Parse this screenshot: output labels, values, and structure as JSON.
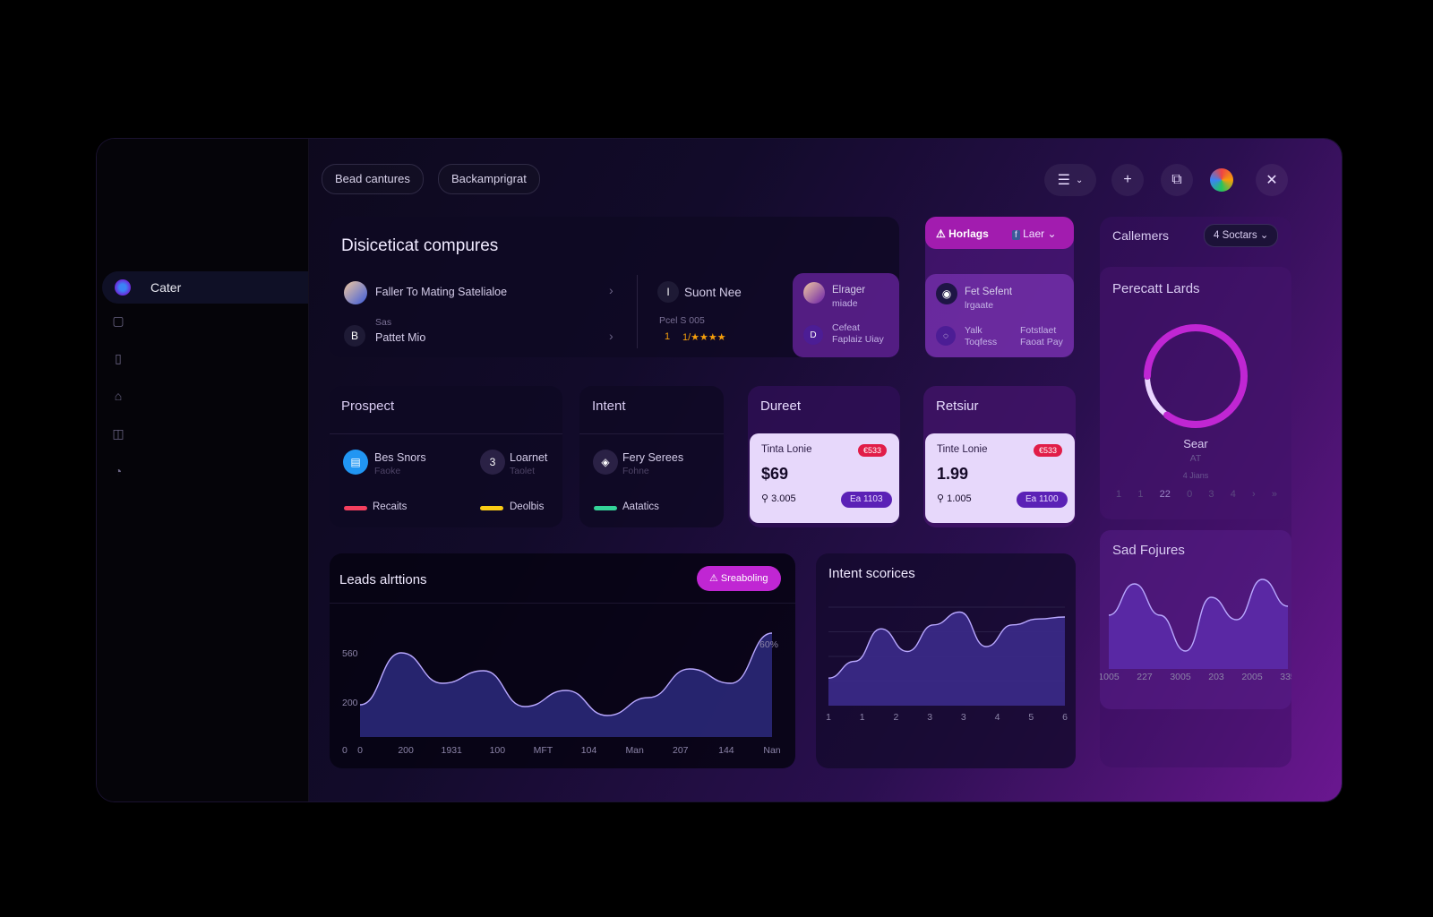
{
  "header": {
    "pill1": "Bead cantures",
    "pill2": "Backamprigrat"
  },
  "sidebar": {
    "active_label": "Cater"
  },
  "top_card": {
    "title": "Disiceticat compures",
    "item1": "Faller To Mating Satelialoe",
    "item2_sub": "Sas",
    "item2": "Pattet Mio",
    "item2_icon": "B",
    "mid_title": "Suont Nee",
    "mid_icon": "I",
    "mid_sub": "Pcel S 005",
    "mid_num": "1",
    "mid_stars": "1/★★★★",
    "mini1_title": "Elrager",
    "mini1_sub": "miade",
    "mini1_bottom_a": "Cefeat",
    "mini1_bottom_b": "Faplaiz Uiay",
    "mini1_icon": "D"
  },
  "right_top": {
    "tab1": "Horlags",
    "tab2": "Laer",
    "card_title": "Fet Sefent",
    "card_sub": "lrgaate",
    "foot_a1": "Yalk",
    "foot_a2": "Toqfess",
    "foot_b1": "Fotstlaet",
    "foot_b2": "Faoat Pay"
  },
  "far_right": {
    "title": "Callemers",
    "select": "Soctars",
    "select_prefix": "4",
    "gauge_title": "Perecatt Lards",
    "gauge_value": 0.85,
    "gauge_label": "Sear",
    "gauge_sub": "AT",
    "gauge_sub2": "4 Jians",
    "pager": [
      "1",
      "1",
      "22",
      "0",
      "3",
      "4",
      "›",
      "»"
    ],
    "chart_title": "Sad Fojures"
  },
  "prospect": {
    "title": "Prospect",
    "item1": "Bes Snors",
    "item1_sub": "Faoke",
    "item2": "Loarnet",
    "item2_sub": "Taolet",
    "item2_icon": "3",
    "leg1": "Recaits",
    "leg2": "Deolbis"
  },
  "intent": {
    "title": "Intent",
    "item": "Fery Serees",
    "item_sub": "Fohne",
    "leg": "Aatatics"
  },
  "duret": {
    "title": "Dureet",
    "label": "Tinta Lonie",
    "badge": "€533",
    "price": "$69",
    "meta": "3.005",
    "btn": "Ea 1103"
  },
  "retsur": {
    "title": "Retsiur",
    "label": "Tinte Lonie",
    "badge": "€533",
    "price": "1.99",
    "meta": "1.005",
    "btn": "Ea 1100"
  },
  "leads_chart": {
    "title": "Leads alrttions",
    "button": "Sreaboling",
    "percent": "60%"
  },
  "intent_chart": {
    "title": "Intent scorices"
  },
  "colors": {
    "accent": "#c026d3",
    "area": "#2a2878",
    "line": "#b9a8ff"
  },
  "chart_data": [
    {
      "type": "area",
      "title": "Leads alrttions",
      "x": [
        "0",
        "200",
        "1931",
        "100",
        "MFT",
        "104",
        "Man",
        "207",
        "144",
        "Nan"
      ],
      "y_ticks": [
        "0",
        "200",
        "560"
      ],
      "ylim": [
        0,
        650
      ],
      "series": [
        {
          "values": [
            180,
            470,
            300,
            370,
            170,
            260,
            120,
            220,
            380,
            300,
            580
          ]
        }
      ]
    },
    {
      "type": "area",
      "title": "Intent scorices",
      "x": [
        "1",
        "1",
        "2",
        "3",
        "3",
        "4",
        "5",
        "6"
      ],
      "ylim": [
        0,
        100
      ],
      "series": [
        {
          "values": [
            28,
            45,
            78,
            55,
            82,
            95,
            60,
            82,
            88,
            90
          ]
        }
      ]
    },
    {
      "type": "area",
      "title": "Sad Fojures",
      "x": [
        "1005",
        "227",
        "3005",
        "203",
        "2005",
        "335"
      ],
      "ylim": [
        0,
        100
      ],
      "series": [
        {
          "values": [
            60,
            95,
            60,
            20,
            80,
            55,
            100,
            70
          ]
        }
      ]
    }
  ]
}
